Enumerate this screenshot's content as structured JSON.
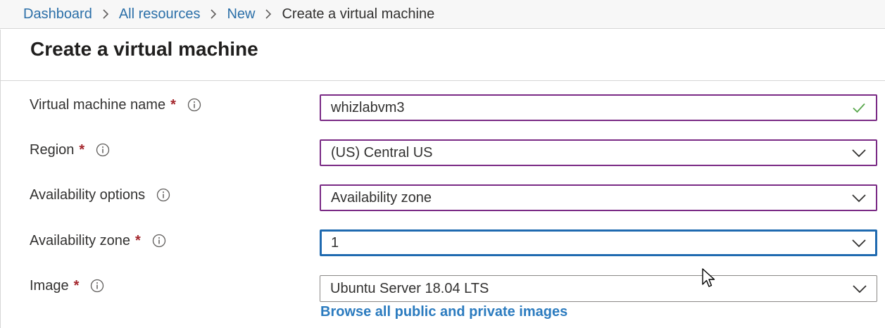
{
  "breadcrumb": {
    "items": [
      "Dashboard",
      "All resources",
      "New"
    ],
    "current": "Create a virtual machine"
  },
  "page": {
    "title": "Create a virtual machine"
  },
  "form": {
    "vm_name": {
      "label": "Virtual machine name",
      "required": "*",
      "value": "whizlabvm3"
    },
    "region": {
      "label": "Region",
      "required": "*",
      "value": "(US) Central US"
    },
    "availability_options": {
      "label": "Availability options",
      "value": "Availability zone"
    },
    "availability_zone": {
      "label": "Availability zone",
      "required": "*",
      "value": "1"
    },
    "image": {
      "label": "Image",
      "required": "*",
      "value": "Ubuntu Server 18.04 LTS"
    },
    "browse_images_link": "Browse all public and private images"
  },
  "colors": {
    "link": "#2b6fa8",
    "required": "#a4262c",
    "input_border": "#7a2a85",
    "focus_border": "#1f6ab0",
    "valid_check": "#57a64a"
  },
  "icons": {
    "info": "info-icon",
    "dropdown": "chevron-down-icon",
    "valid": "checkmark-icon",
    "breadcrumb_separator": "chevron-right-icon"
  }
}
